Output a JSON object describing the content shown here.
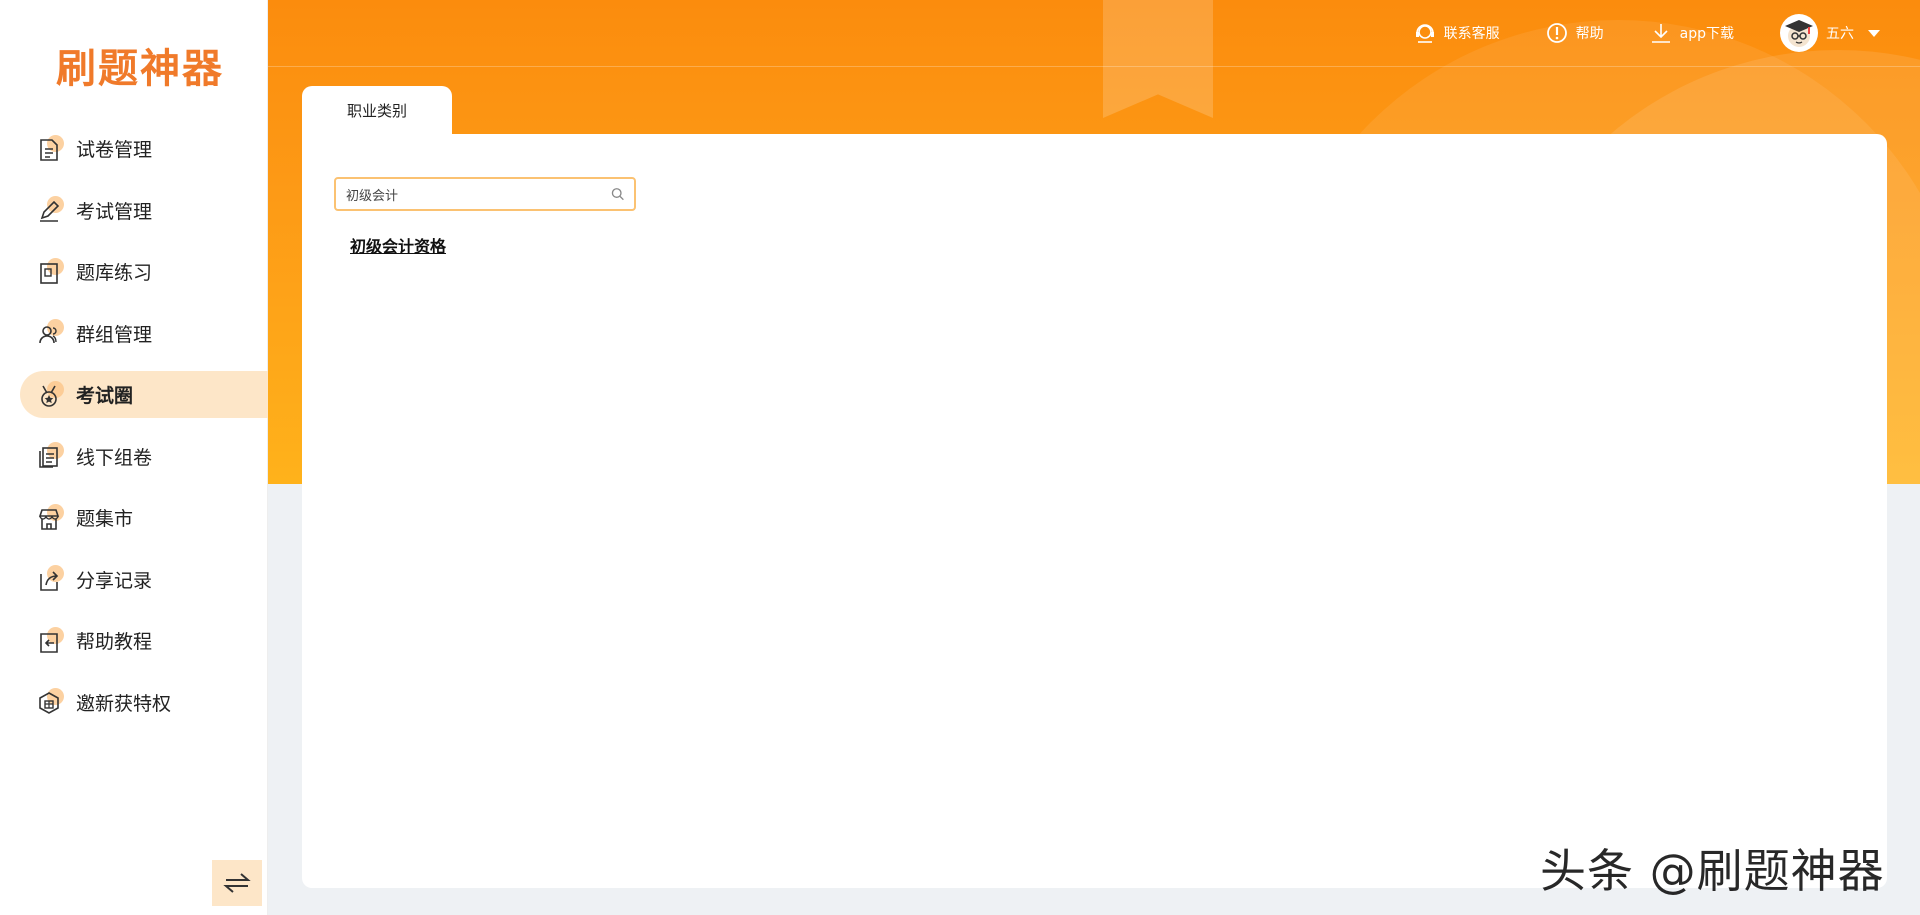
{
  "logo": {
    "text": "刷题神器"
  },
  "sidebar": {
    "items": [
      {
        "label": "试卷管理",
        "icon": "document-icon"
      },
      {
        "label": "考试管理",
        "icon": "pen-icon"
      },
      {
        "label": "题库练习",
        "icon": "book-icon"
      },
      {
        "label": "群组管理",
        "icon": "group-icon"
      },
      {
        "label": "考试圈",
        "icon": "medal-icon",
        "active": true
      },
      {
        "label": "线下组卷",
        "icon": "stack-icon"
      },
      {
        "label": "题集市",
        "icon": "store-icon"
      },
      {
        "label": "分享记录",
        "icon": "share-icon"
      },
      {
        "label": "帮助教程",
        "icon": "help-return-icon"
      },
      {
        "label": "邀新获特权",
        "icon": "gift-icon"
      }
    ],
    "collapse_icon": "swap-arrows-icon"
  },
  "topbar": {
    "support": "联系客服",
    "help": "帮助",
    "download": "app下载",
    "username": "五六"
  },
  "tab": {
    "label": "职业类别"
  },
  "search": {
    "value": "初级会计"
  },
  "results": [
    "初级会计资格"
  ],
  "watermark": "头条 @刷题神器",
  "colors": {
    "accent": "#fb8c0d",
    "active_bg": "#fde6c8",
    "input_border": "#fbc272"
  }
}
